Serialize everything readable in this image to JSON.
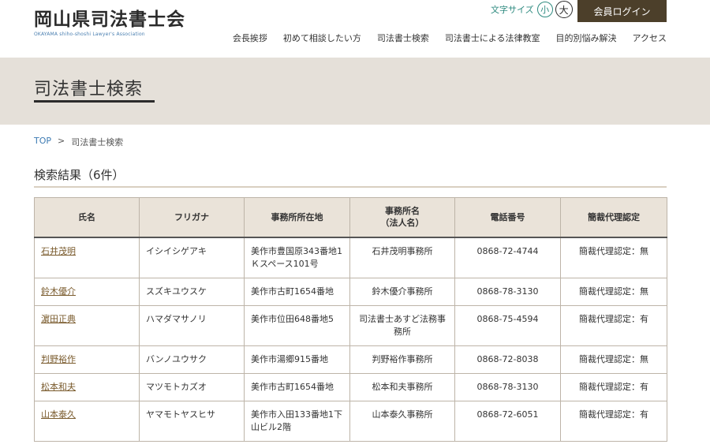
{
  "header": {
    "logo_title": "岡山県司法書士会",
    "logo_sub": "OKAYAMA shiho-shoshi Lawyer's Association",
    "font_size_label": "文字サイズ",
    "font_small": "小",
    "font_large": "大",
    "login_label": "会員ログイン"
  },
  "nav": {
    "items": [
      "会長挨拶",
      "初めて相談したい方",
      "司法書士検索",
      "司法書士による法律教室",
      "目的別悩み解決",
      "アクセス"
    ]
  },
  "banner": {
    "title": "司法書士検索"
  },
  "breadcrumb": {
    "top": "TOP",
    "sep": ">",
    "current": "司法書士検索"
  },
  "results": {
    "title": "検索結果（6件）",
    "headers": {
      "name": "氏名",
      "kana": "フリガナ",
      "address": "事務所所在地",
      "office_line1": "事務所名",
      "office_line2": "（法人名）",
      "phone": "電話番号",
      "adr": "簡裁代理認定"
    },
    "rows": [
      {
        "name": "石井茂明",
        "kana": "イシイシゲアキ",
        "address": "美作市豊国原343番地1 Ｋスペース101号",
        "office": "石井茂明事務所",
        "phone": "0868-72-4744",
        "adr": "簡裁代理認定：無"
      },
      {
        "name": "鈴木優介",
        "kana": "スズキユウスケ",
        "address": "美作市古町1654番地",
        "office": "鈴木優介事務所",
        "phone": "0868-78-3130",
        "adr": "簡裁代理認定：無"
      },
      {
        "name": "濵田正典",
        "kana": "ハマダマサノリ",
        "address": "美作市位田648番地5",
        "office": "司法書士あすど法務事務所",
        "phone": "0868-75-4594",
        "adr": "簡裁代理認定：有"
      },
      {
        "name": "判野裕作",
        "kana": "バンノユウサク",
        "address": "美作市湯郷915番地",
        "office": "判野裕作事務所",
        "phone": "0868-72-8038",
        "adr": "簡裁代理認定：無"
      },
      {
        "name": "松本和夫",
        "kana": "マツモトカズオ",
        "address": "美作市古町1654番地",
        "office": "松本和夫事務所",
        "phone": "0868-78-3130",
        "adr": "簡裁代理認定：有"
      },
      {
        "name": "山本泰久",
        "kana": "ヤマモトヤスヒサ",
        "address": "美作市入田133番地1下山ビル2階",
        "office": "山本泰久事務所",
        "phone": "0868-72-6051",
        "adr": "簡裁代理認定：有"
      }
    ]
  }
}
